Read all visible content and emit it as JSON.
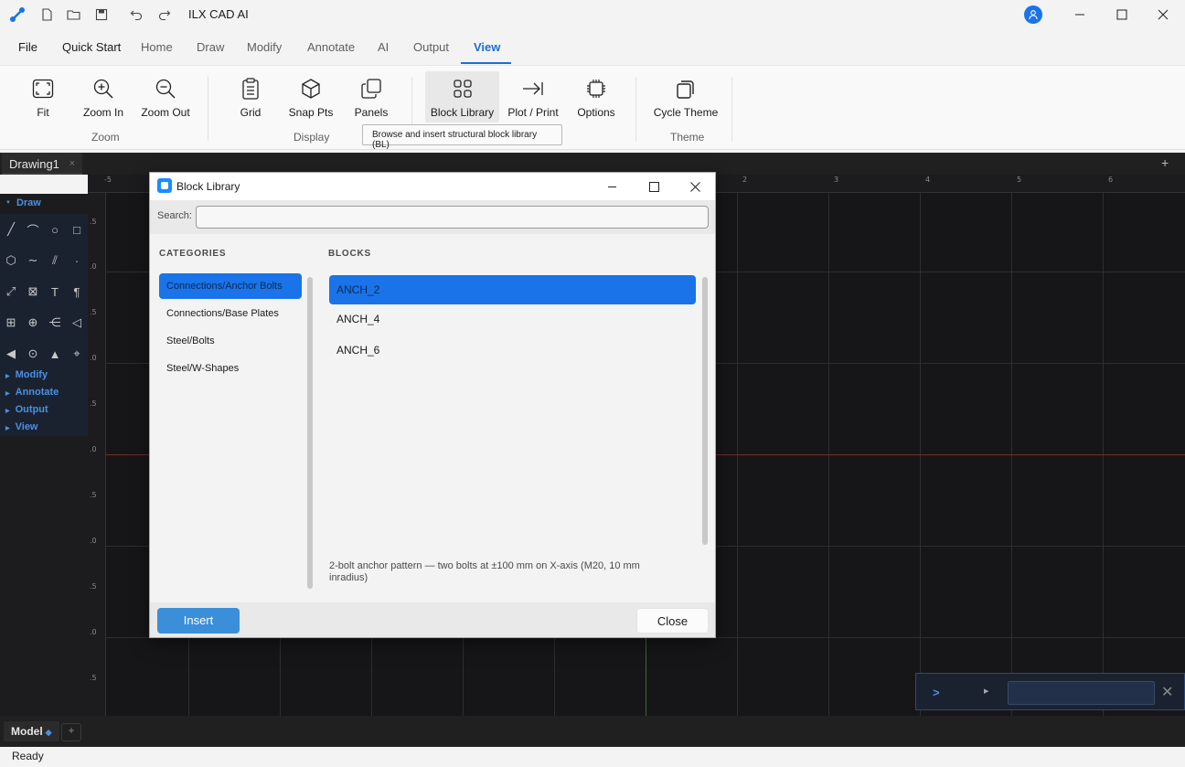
{
  "window": {
    "title": "ILX CAD AI"
  },
  "menu": {
    "items": [
      "File",
      "Quick Start",
      "Home",
      "Draw",
      "Modify",
      "Annotate",
      "AI",
      "Output",
      "View"
    ],
    "active": "View"
  },
  "ribbon": {
    "zoom": {
      "label": "Zoom",
      "fit": "Fit",
      "zoom_in": "Zoom In",
      "zoom_out": "Zoom Out"
    },
    "display": {
      "label": "Display",
      "grid": "Grid",
      "snap": "Snap Pts",
      "panels": "Panels"
    },
    "tools": {
      "block_library": "Block Library",
      "plot": "Plot / Print",
      "options": "Options"
    },
    "theme": {
      "label": "Theme",
      "cycle": "Cycle Theme"
    },
    "tooltip": "Browse and insert structural block library (BL)"
  },
  "drawing_tab": {
    "label": "Drawing1",
    "close": "×",
    "add": "+"
  },
  "ruler": {
    "top": [
      "-5",
      "2",
      "3",
      "4",
      "5",
      "6"
    ],
    "left": [
      ".5",
      ".0",
      ".5",
      ".0",
      ".5",
      ".0",
      ".5",
      ".0",
      ".5",
      ".0",
      ".5",
      ".0",
      ".5"
    ]
  },
  "palette": {
    "draw": "Draw",
    "sections": [
      "Modify",
      "Annotate",
      "Output",
      "View"
    ],
    "tools": [
      "╱",
      "⌒",
      "○",
      "□",
      "⬡",
      "∼",
      "⫽",
      "·",
      "⤢",
      "⊠",
      "T",
      "¶",
      "⊞",
      "⊕",
      "⋲",
      "◁",
      "◀",
      "⊙",
      "▲",
      "⌖"
    ]
  },
  "dialog": {
    "title": "Block Library",
    "search_label": "Search:",
    "search_value": "",
    "categories_header": "CATEGORIES",
    "blocks_header": "BLOCKS",
    "categories": [
      "Connections/Anchor Bolts",
      "Connections/Base Plates",
      "Steel/Bolts",
      "Steel/W-Shapes"
    ],
    "selected_category": "Connections/Anchor Bolts",
    "blocks": [
      "ANCH_2",
      "ANCH_4",
      "ANCH_6"
    ],
    "selected_block": "ANCH_2",
    "description": "2-bolt anchor pattern — two bolts at ±100 mm on X-axis (M20, 10 mm inradius)",
    "insert_label": "Insert",
    "close_label": "Close"
  },
  "layout_tabs": {
    "model": "Model",
    "add": "+"
  },
  "command": {
    "prompt": ">",
    "value": ""
  },
  "status": {
    "text": "Ready"
  },
  "colors": {
    "accent": "#1a73e8",
    "canvas": "#161618"
  }
}
